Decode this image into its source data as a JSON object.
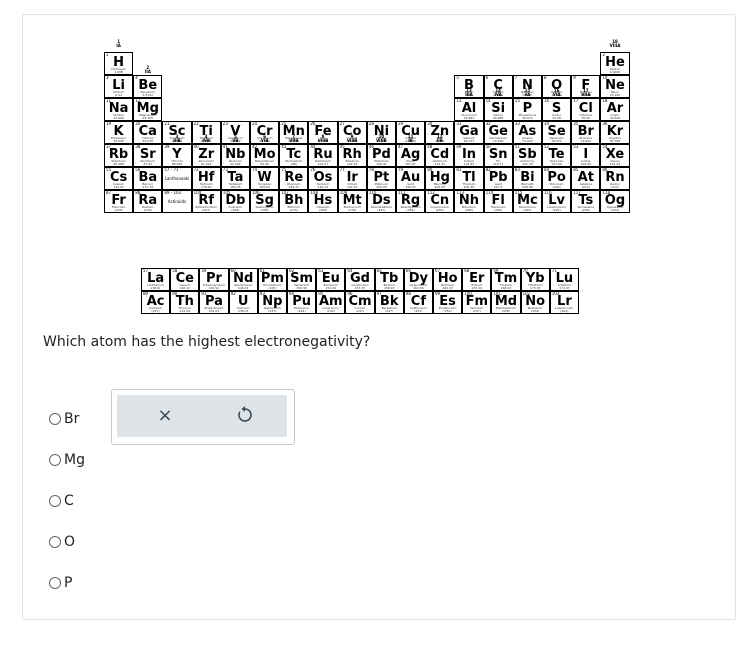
{
  "group_labels_top": [
    "1\nIA",
    "18\nVIIIA"
  ],
  "group_labels": [
    {
      "t": "2\nIIA"
    },
    {
      "t": "13\nIIIA"
    },
    {
      "t": "14\nIVA"
    },
    {
      "t": "15\nVA"
    },
    {
      "t": "16\nVIA"
    },
    {
      "t": "17\nVIIA"
    },
    {
      "t": "3\nIIIB"
    },
    {
      "t": "4\nIVB"
    },
    {
      "t": "5\nVB"
    },
    {
      "t": "6\nVIB"
    },
    {
      "t": "7\nVIIB"
    },
    {
      "t": "8\nVIIIB"
    },
    {
      "t": "9\nVIIIB"
    },
    {
      "t": "10\nVIIIB"
    },
    {
      "t": "11\nIB"
    },
    {
      "t": "12\nIIB"
    }
  ],
  "elements": [
    {
      "n": 1,
      "s": "H",
      "name": "Hydrogen",
      "m": "1.008",
      "r": 0,
      "c": 0
    },
    {
      "n": 2,
      "s": "He",
      "name": "Helium",
      "m": "4.0026",
      "r": 0,
      "c": 17
    },
    {
      "n": 3,
      "s": "Li",
      "name": "Lithium",
      "m": "6.94",
      "r": 1,
      "c": 0
    },
    {
      "n": 4,
      "s": "Be",
      "name": "Beryllium",
      "m": "9.0122",
      "r": 1,
      "c": 1
    },
    {
      "n": 5,
      "s": "B",
      "name": "Boron",
      "m": "10.81",
      "r": 1,
      "c": 12
    },
    {
      "n": 6,
      "s": "C",
      "name": "Carbon",
      "m": "12.011",
      "r": 1,
      "c": 13
    },
    {
      "n": 7,
      "s": "N",
      "name": "Nitrogen",
      "m": "14.007",
      "r": 1,
      "c": 14
    },
    {
      "n": 8,
      "s": "O",
      "name": "Oxygen",
      "m": "15.999",
      "r": 1,
      "c": 15
    },
    {
      "n": 9,
      "s": "F",
      "name": "Fluorine",
      "m": "18.998",
      "r": 1,
      "c": 16
    },
    {
      "n": 10,
      "s": "Ne",
      "name": "Neon",
      "m": "20.180",
      "r": 1,
      "c": 17
    },
    {
      "n": 11,
      "s": "Na",
      "name": "Sodium",
      "m": "22.990",
      "r": 2,
      "c": 0
    },
    {
      "n": 12,
      "s": "Mg",
      "name": "Magnesium",
      "m": "24.305",
      "r": 2,
      "c": 1
    },
    {
      "n": 13,
      "s": "Al",
      "name": "Aluminum",
      "m": "26.982",
      "r": 2,
      "c": 12
    },
    {
      "n": 14,
      "s": "Si",
      "name": "Silicon",
      "m": "28.085",
      "r": 2,
      "c": 13
    },
    {
      "n": 15,
      "s": "P",
      "name": "Phosphorus",
      "m": "30.974",
      "r": 2,
      "c": 14
    },
    {
      "n": 16,
      "s": "S",
      "name": "Sulfur",
      "m": "32.06",
      "r": 2,
      "c": 15
    },
    {
      "n": 17,
      "s": "Cl",
      "name": "Chlorine",
      "m": "35.45",
      "r": 2,
      "c": 16
    },
    {
      "n": 18,
      "s": "Ar",
      "name": "Argon",
      "m": "39.948",
      "r": 2,
      "c": 17
    },
    {
      "n": 19,
      "s": "K",
      "name": "Potassium",
      "m": "39.098",
      "r": 3,
      "c": 0
    },
    {
      "n": 20,
      "s": "Ca",
      "name": "Calcium",
      "m": "40.078",
      "r": 3,
      "c": 1
    },
    {
      "n": 21,
      "s": "Sc",
      "name": "Scandium",
      "m": "44.956",
      "r": 3,
      "c": 2
    },
    {
      "n": 22,
      "s": "Ti",
      "name": "Titanium",
      "m": "47.867",
      "r": 3,
      "c": 3
    },
    {
      "n": 23,
      "s": "V",
      "name": "Vanadium",
      "m": "50.942",
      "r": 3,
      "c": 4
    },
    {
      "n": 24,
      "s": "Cr",
      "name": "Chromium",
      "m": "51.996",
      "r": 3,
      "c": 5
    },
    {
      "n": 25,
      "s": "Mn",
      "name": "Manganese",
      "m": "54.938",
      "r": 3,
      "c": 6
    },
    {
      "n": 26,
      "s": "Fe",
      "name": "Iron",
      "m": "55.845",
      "r": 3,
      "c": 7
    },
    {
      "n": 27,
      "s": "Co",
      "name": "Cobalt",
      "m": "58.933",
      "r": 3,
      "c": 8
    },
    {
      "n": 28,
      "s": "Ni",
      "name": "Nickel",
      "m": "58.693",
      "r": 3,
      "c": 9
    },
    {
      "n": 29,
      "s": "Cu",
      "name": "Copper",
      "m": "63.546",
      "r": 3,
      "c": 10
    },
    {
      "n": 30,
      "s": "Zn",
      "name": "Zinc",
      "m": "65.38",
      "r": 3,
      "c": 11
    },
    {
      "n": 31,
      "s": "Ga",
      "name": "Gallium",
      "m": "69.723",
      "r": 3,
      "c": 12
    },
    {
      "n": 32,
      "s": "Ge",
      "name": "Germanium",
      "m": "72.630",
      "r": 3,
      "c": 13
    },
    {
      "n": 33,
      "s": "As",
      "name": "Arsenic",
      "m": "74.922",
      "r": 3,
      "c": 14
    },
    {
      "n": 34,
      "s": "Se",
      "name": "Selenium",
      "m": "78.971",
      "r": 3,
      "c": 15
    },
    {
      "n": 35,
      "s": "Br",
      "name": "Bromine",
      "m": "79.904",
      "r": 3,
      "c": 16
    },
    {
      "n": 36,
      "s": "Kr",
      "name": "Krypton",
      "m": "83.798",
      "r": 3,
      "c": 17
    },
    {
      "n": 37,
      "s": "Rb",
      "name": "Rubidium",
      "m": "85.468",
      "r": 4,
      "c": 0
    },
    {
      "n": 38,
      "s": "Sr",
      "name": "Strontium",
      "m": "87.62",
      "r": 4,
      "c": 1
    },
    {
      "n": 39,
      "s": "Y",
      "name": "Yttrium",
      "m": "88.906",
      "r": 4,
      "c": 2
    },
    {
      "n": 40,
      "s": "Zr",
      "name": "Zirconium",
      "m": "91.224",
      "r": 4,
      "c": 3
    },
    {
      "n": 41,
      "s": "Nb",
      "name": "Niobium",
      "m": "92.906",
      "r": 4,
      "c": 4
    },
    {
      "n": 42,
      "s": "Mo",
      "name": "Molybdenum",
      "m": "95.95",
      "r": 4,
      "c": 5
    },
    {
      "n": 43,
      "s": "Tc",
      "name": "Technetium",
      "m": "(98)",
      "r": 4,
      "c": 6
    },
    {
      "n": 44,
      "s": "Ru",
      "name": "Ruthenium",
      "m": "101.07",
      "r": 4,
      "c": 7
    },
    {
      "n": 45,
      "s": "Rh",
      "name": "Rhodium",
      "m": "102.91",
      "r": 4,
      "c": 8
    },
    {
      "n": 46,
      "s": "Pd",
      "name": "Palladium",
      "m": "106.42",
      "r": 4,
      "c": 9
    },
    {
      "n": 47,
      "s": "Ag",
      "name": "Silver",
      "m": "107.87",
      "r": 4,
      "c": 10
    },
    {
      "n": 48,
      "s": "Cd",
      "name": "Cadmium",
      "m": "112.41",
      "r": 4,
      "c": 11
    },
    {
      "n": 49,
      "s": "In",
      "name": "Indium",
      "m": "114.82",
      "r": 4,
      "c": 12
    },
    {
      "n": 50,
      "s": "Sn",
      "name": "Tin",
      "m": "118.71",
      "r": 4,
      "c": 13
    },
    {
      "n": 51,
      "s": "Sb",
      "name": "Antimony",
      "m": "121.76",
      "r": 4,
      "c": 14
    },
    {
      "n": 52,
      "s": "Te",
      "name": "Tellurium",
      "m": "127.60",
      "r": 4,
      "c": 15
    },
    {
      "n": 53,
      "s": "I",
      "name": "Iodine",
      "m": "126.90",
      "r": 4,
      "c": 16
    },
    {
      "n": 54,
      "s": "Xe",
      "name": "Xenon",
      "m": "131.29",
      "r": 4,
      "c": 17
    },
    {
      "n": 55,
      "s": "Cs",
      "name": "Cesium",
      "m": "132.91",
      "r": 5,
      "c": 0
    },
    {
      "n": 56,
      "s": "Ba",
      "name": "Barium",
      "m": "137.33",
      "r": 5,
      "c": 1
    },
    {
      "n": "57 - 71",
      "s": "Lanthanoids",
      "name": "",
      "m": "",
      "r": 5,
      "c": 2,
      "small": true
    },
    {
      "n": 72,
      "s": "Hf",
      "name": "Hafnium",
      "m": "178.49",
      "r": 5,
      "c": 3
    },
    {
      "n": 73,
      "s": "Ta",
      "name": "Tantalum",
      "m": "180.95",
      "r": 5,
      "c": 4
    },
    {
      "n": 74,
      "s": "W",
      "name": "Tungsten",
      "m": "183.84",
      "r": 5,
      "c": 5
    },
    {
      "n": 75,
      "s": "Re",
      "name": "Rhenium",
      "m": "186.21",
      "r": 5,
      "c": 6
    },
    {
      "n": 76,
      "s": "Os",
      "name": "Osmium",
      "m": "190.23",
      "r": 5,
      "c": 7
    },
    {
      "n": 77,
      "s": "Ir",
      "name": "Iridium",
      "m": "192.22",
      "r": 5,
      "c": 8
    },
    {
      "n": 78,
      "s": "Pt",
      "name": "Platinum",
      "m": "195.08",
      "r": 5,
      "c": 9
    },
    {
      "n": 79,
      "s": "Au",
      "name": "Gold",
      "m": "196.97",
      "r": 5,
      "c": 10
    },
    {
      "n": 80,
      "s": "Hg",
      "name": "Mercury",
      "m": "200.59",
      "r": 5,
      "c": 11
    },
    {
      "n": 81,
      "s": "Tl",
      "name": "Thallium",
      "m": "204.38",
      "r": 5,
      "c": 12
    },
    {
      "n": 82,
      "s": "Pb",
      "name": "Lead",
      "m": "207.2",
      "r": 5,
      "c": 13
    },
    {
      "n": 83,
      "s": "Bi",
      "name": "Bismuth",
      "m": "208.98",
      "r": 5,
      "c": 14
    },
    {
      "n": 84,
      "s": "Po",
      "name": "Polonium",
      "m": "(209)",
      "r": 5,
      "c": 15
    },
    {
      "n": 85,
      "s": "At",
      "name": "Astatine",
      "m": "(210)",
      "r": 5,
      "c": 16
    },
    {
      "n": 86,
      "s": "Rn",
      "name": "Radon",
      "m": "(222)",
      "r": 5,
      "c": 17
    },
    {
      "n": 87,
      "s": "Fr",
      "name": "Francium",
      "m": "(223)",
      "r": 6,
      "c": 0
    },
    {
      "n": 88,
      "s": "Ra",
      "name": "Radium",
      "m": "(226)",
      "r": 6,
      "c": 1
    },
    {
      "n": "89 - 103",
      "s": "Actinoids",
      "name": "",
      "m": "",
      "r": 6,
      "c": 2,
      "small": true
    },
    {
      "n": 104,
      "s": "Rf",
      "name": "Rutherfordium",
      "m": "(267)",
      "r": 6,
      "c": 3
    },
    {
      "n": 105,
      "s": "Db",
      "name": "Dubnium",
      "m": "(268)",
      "r": 6,
      "c": 4
    },
    {
      "n": 106,
      "s": "Sg",
      "name": "Seaborgium",
      "m": "(269)",
      "r": 6,
      "c": 5
    },
    {
      "n": 107,
      "s": "Bh",
      "name": "Bohrium",
      "m": "(270)",
      "r": 6,
      "c": 6
    },
    {
      "n": 108,
      "s": "Hs",
      "name": "Hassium",
      "m": "(269)",
      "r": 6,
      "c": 7
    },
    {
      "n": 109,
      "s": "Mt",
      "name": "Meitnerium",
      "m": "(278)",
      "r": 6,
      "c": 8
    },
    {
      "n": 110,
      "s": "Ds",
      "name": "Darmstadtium",
      "m": "(281)",
      "r": 6,
      "c": 9
    },
    {
      "n": 111,
      "s": "Rg",
      "name": "Roentgenium",
      "m": "(282)",
      "r": 6,
      "c": 10
    },
    {
      "n": 112,
      "s": "Cn",
      "name": "Copernicium",
      "m": "(285)",
      "r": 6,
      "c": 11
    },
    {
      "n": 113,
      "s": "Nh",
      "name": "Nihonium",
      "m": "(286)",
      "r": 6,
      "c": 12
    },
    {
      "n": 114,
      "s": "Fl",
      "name": "Flerovium",
      "m": "(289)",
      "r": 6,
      "c": 13
    },
    {
      "n": 115,
      "s": "Mc",
      "name": "Moscovium",
      "m": "(290)",
      "r": 6,
      "c": 14
    },
    {
      "n": 116,
      "s": "Lv",
      "name": "Livermorium",
      "m": "(293)",
      "r": 6,
      "c": 15
    },
    {
      "n": 117,
      "s": "Ts",
      "name": "Tennessine",
      "m": "(294)",
      "r": 6,
      "c": 16
    },
    {
      "n": 118,
      "s": "Og",
      "name": "Oganesson",
      "m": "(294)",
      "r": 6,
      "c": 17
    }
  ],
  "f_block": [
    {
      "n": 57,
      "s": "La",
      "name": "Lanthanum",
      "m": "138.91",
      "r": 0,
      "c": 0
    },
    {
      "n": 58,
      "s": "Ce",
      "name": "Cerium",
      "m": "140.12",
      "r": 0,
      "c": 1
    },
    {
      "n": 59,
      "s": "Pr",
      "name": "Praseodymium",
      "m": "140.91",
      "r": 0,
      "c": 2
    },
    {
      "n": 60,
      "s": "Nd",
      "name": "Neodymium",
      "m": "144.24",
      "r": 0,
      "c": 3
    },
    {
      "n": 61,
      "s": "Pm",
      "name": "Promethium",
      "m": "(145)",
      "r": 0,
      "c": 4
    },
    {
      "n": 62,
      "s": "Sm",
      "name": "Samarium",
      "m": "150.36",
      "r": 0,
      "c": 5
    },
    {
      "n": 63,
      "s": "Eu",
      "name": "Europium",
      "m": "151.96",
      "r": 0,
      "c": 6
    },
    {
      "n": 64,
      "s": "Gd",
      "name": "Gadolinium",
      "m": "157.25",
      "r": 0,
      "c": 7
    },
    {
      "n": 65,
      "s": "Tb",
      "name": "Terbium",
      "m": "158.93",
      "r": 0,
      "c": 8
    },
    {
      "n": 66,
      "s": "Dy",
      "name": "Dysprosium",
      "m": "162.50",
      "r": 0,
      "c": 9
    },
    {
      "n": 67,
      "s": "Ho",
      "name": "Holmium",
      "m": "164.93",
      "r": 0,
      "c": 10
    },
    {
      "n": 68,
      "s": "Er",
      "name": "Erbium",
      "m": "167.26",
      "r": 0,
      "c": 11
    },
    {
      "n": 69,
      "s": "Tm",
      "name": "Thulium",
      "m": "168.93",
      "r": 0,
      "c": 12
    },
    {
      "n": 70,
      "s": "Yb",
      "name": "Ytterbium",
      "m": "173.05",
      "r": 0,
      "c": 13
    },
    {
      "n": 71,
      "s": "Lu",
      "name": "Lutetium",
      "m": "174.97",
      "r": 0,
      "c": 14
    },
    {
      "n": 89,
      "s": "Ac",
      "name": "Actinium",
      "m": "(227)",
      "r": 1,
      "c": 0
    },
    {
      "n": 90,
      "s": "Th",
      "name": "Thorium",
      "m": "232.04",
      "r": 1,
      "c": 1
    },
    {
      "n": 91,
      "s": "Pa",
      "name": "Protactinium",
      "m": "231.04",
      "r": 1,
      "c": 2
    },
    {
      "n": 92,
      "s": "U",
      "name": "Uranium",
      "m": "238.03",
      "r": 1,
      "c": 3
    },
    {
      "n": 93,
      "s": "Np",
      "name": "Neptunium",
      "m": "(237)",
      "r": 1,
      "c": 4
    },
    {
      "n": 94,
      "s": "Pu",
      "name": "Plutonium",
      "m": "(244)",
      "r": 1,
      "c": 5
    },
    {
      "n": 95,
      "s": "Am",
      "name": "Americium",
      "m": "(243)",
      "r": 1,
      "c": 6
    },
    {
      "n": 96,
      "s": "Cm",
      "name": "Curium",
      "m": "(247)",
      "r": 1,
      "c": 7
    },
    {
      "n": 97,
      "s": "Bk",
      "name": "Berkelium",
      "m": "(247)",
      "r": 1,
      "c": 8
    },
    {
      "n": 98,
      "s": "Cf",
      "name": "Californium",
      "m": "(251)",
      "r": 1,
      "c": 9
    },
    {
      "n": 99,
      "s": "Es",
      "name": "Einsteinium",
      "m": "(252)",
      "r": 1,
      "c": 10
    },
    {
      "n": 100,
      "s": "Fm",
      "name": "Fermium",
      "m": "(257)",
      "r": 1,
      "c": 11
    },
    {
      "n": 101,
      "s": "Md",
      "name": "Mendelevium",
      "m": "(258)",
      "r": 1,
      "c": 12
    },
    {
      "n": 102,
      "s": "No",
      "name": "Nobelium",
      "m": "(259)",
      "r": 1,
      "c": 13
    },
    {
      "n": 103,
      "s": "Lr",
      "name": "Lawrencium",
      "m": "(262)",
      "r": 1,
      "c": 14
    }
  ],
  "question": "Which atom has the highest electronegativity?",
  "answer_controls": {
    "clear_glyph": "×",
    "undo_icon": "undo-icon"
  },
  "options": [
    "Br",
    "Mg",
    "C",
    "O",
    "P"
  ],
  "colors": {
    "answer_bg": "#dde3e7",
    "icon": "#3b4a57"
  }
}
